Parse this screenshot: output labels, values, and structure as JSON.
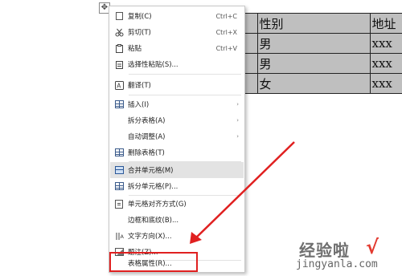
{
  "table": {
    "rows": [
      [
        "",
        "性别",
        "地址"
      ],
      [
        "",
        "男",
        "xxx"
      ],
      [
        "",
        "男",
        "xxx"
      ],
      [
        "",
        "女",
        "xxx"
      ]
    ]
  },
  "move_handle_glyph": "✥",
  "context_menu": {
    "items": [
      {
        "label": "复制(C)",
        "shortcut": "Ctrl+C",
        "icon": "copy-icon"
      },
      {
        "label": "剪切(T)",
        "shortcut": "Ctrl+X",
        "icon": "scissors-icon"
      },
      {
        "label": "粘贴",
        "shortcut": "Ctrl+V",
        "icon": "paste-icon"
      },
      {
        "label": "选择性粘贴(S)...",
        "icon": "paste-special-icon"
      },
      {
        "label": "翻译(T)",
        "icon": "translate-icon"
      },
      {
        "label": "插入(I)",
        "icon": "insert-table-icon",
        "arrow": "›"
      },
      {
        "label": "拆分表格(A)",
        "arrow": "›"
      },
      {
        "label": "自动调整(A)",
        "arrow": "›"
      },
      {
        "label": "删除表格(T)",
        "icon": "delete-table-icon"
      },
      {
        "label": "合并单元格(M)",
        "icon": "merge-cells-icon"
      },
      {
        "label": "拆分单元格(P)...",
        "icon": "split-cells-icon"
      },
      {
        "label": "单元格对齐方式(G)",
        "icon": "cell-align-icon"
      },
      {
        "label": "边框和底纹(B)..."
      },
      {
        "label": "文字方向(X)...",
        "icon": "text-direction-icon"
      },
      {
        "label": "题注(Z)...",
        "icon": "caption-icon"
      },
      {
        "label": "表格属性(R)..."
      }
    ]
  },
  "watermark": {
    "title": "经验啦",
    "check": "√",
    "url": "jingyanla.com"
  },
  "colors": {
    "highlight": "#e3e3e3",
    "annotation_red": "#e02020",
    "table_selection": "#bfbfbf"
  }
}
